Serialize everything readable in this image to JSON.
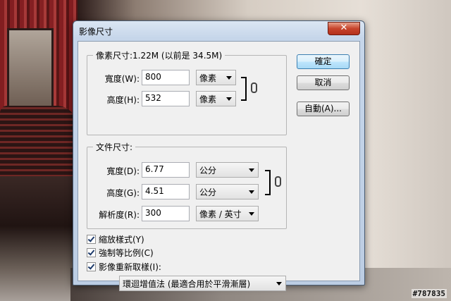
{
  "dialog": {
    "title": "影像尺寸",
    "close_label": "✕"
  },
  "pixel_dimensions": {
    "legend": "像素尺寸:1.22M (以前是 34.5M)",
    "width": {
      "label": "寬度(W):",
      "value": "800",
      "unit": "像素"
    },
    "height": {
      "label": "高度(H):",
      "value": "532",
      "unit": "像素"
    }
  },
  "document_size": {
    "legend": "文件尺寸:",
    "width": {
      "label": "寬度(D):",
      "value": "6.77",
      "unit": "公分"
    },
    "height": {
      "label": "高度(G):",
      "value": "4.51",
      "unit": "公分"
    },
    "resolution": {
      "label": "解析度(R):",
      "value": "300",
      "unit": "像素 / 英寸"
    }
  },
  "options": {
    "scale_styles": {
      "label": "縮放樣式(Y)",
      "checked": true
    },
    "constrain_proportions": {
      "label": "強制等比例(C)",
      "checked": true
    },
    "resample_image": {
      "label": "影像重新取樣(I):",
      "checked": true
    },
    "resample_method": "環迴增值法 (最適合用於平滑漸層)"
  },
  "buttons": {
    "ok": "確定",
    "cancel": "取消",
    "auto": "自動(A)..."
  },
  "watermark": "#787835",
  "icons": {
    "link_pixel": "link-chain-icon",
    "link_document": "link-chain-icon",
    "dropdown": "chevron-down-icon"
  }
}
